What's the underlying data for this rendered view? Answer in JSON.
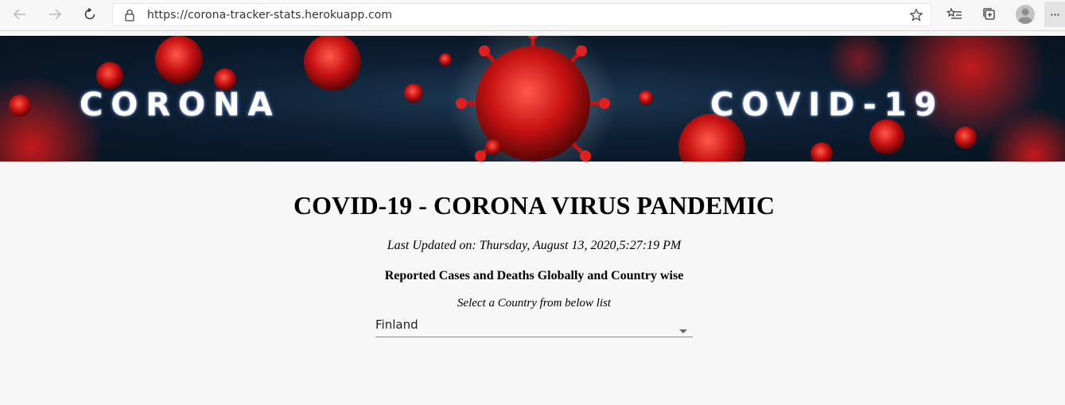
{
  "browser": {
    "url": "https://corona-tracker-stats.herokuapp.com",
    "more_label": "···"
  },
  "banner": {
    "left_text": "CORONA",
    "right_text": "COVID-19"
  },
  "page": {
    "title": "COVID-19 - CORONA VIRUS PANDEMIC",
    "last_updated": "Last Updated on: Thursday, August 13, 2020,5:27:19 PM",
    "subtitle": "Reported Cases and Deaths Globally and Country wise",
    "select_label": "Select a Country from below list",
    "selected_country": "Finland"
  },
  "colors": {
    "virus_red": "#d01818",
    "banner_dark": "#0d1f33",
    "page_bg": "#f7f7f7"
  }
}
